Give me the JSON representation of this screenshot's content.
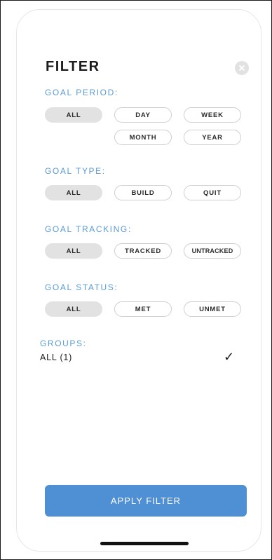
{
  "header": {
    "title": "FILTER"
  },
  "sections": {
    "goal_period": {
      "label": "GOAL PERIOD:",
      "options": [
        "ALL",
        "DAY",
        "WEEK",
        "MONTH",
        "YEAR"
      ],
      "selected": "ALL"
    },
    "goal_type": {
      "label": "GOAL TYPE:",
      "options": [
        "ALL",
        "BUILD",
        "QUIT"
      ],
      "selected": "ALL"
    },
    "goal_tracking": {
      "label": "GOAL TRACKING:",
      "options": [
        "ALL",
        "TRACKED",
        "UNTRACKED"
      ],
      "selected": "ALL"
    },
    "goal_status": {
      "label": "GOAL STATUS:",
      "options": [
        "ALL",
        "MET",
        "UNMET"
      ],
      "selected": "ALL"
    }
  },
  "groups": {
    "label": "GROUPS:",
    "items": [
      {
        "name": "ALL (1)",
        "checked": true,
        "check_glyph": "✓"
      }
    ]
  },
  "apply_button": {
    "label": "APPLY FILTER"
  },
  "colors": {
    "accent": "#5b9bd5",
    "button": "#4f8fd4",
    "chip_selected": "#e2e2e2"
  },
  "icons": {
    "close": "close-icon",
    "check": "check-icon"
  }
}
